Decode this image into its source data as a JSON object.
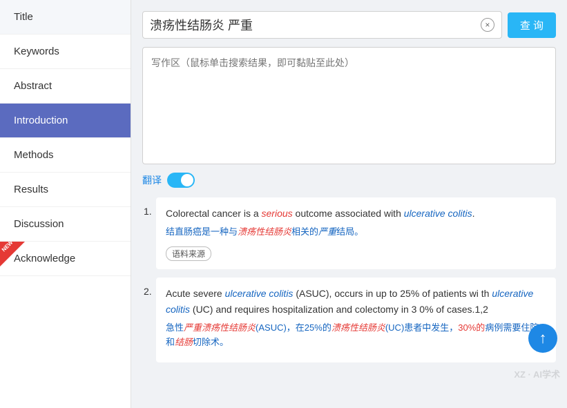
{
  "sidebar": {
    "items": [
      {
        "id": "title",
        "label": "Title",
        "active": false,
        "new": false
      },
      {
        "id": "keywords",
        "label": "Keywords",
        "active": false,
        "new": false
      },
      {
        "id": "abstract",
        "label": "Abstract",
        "active": false,
        "new": false
      },
      {
        "id": "introduction",
        "label": "Introduction",
        "active": true,
        "new": false
      },
      {
        "id": "methods",
        "label": "Methods",
        "active": false,
        "new": false
      },
      {
        "id": "results",
        "label": "Results",
        "active": false,
        "new": false
      },
      {
        "id": "discussion",
        "label": "Discussion",
        "active": false,
        "new": false
      },
      {
        "id": "acknowledge",
        "label": "Acknowledge",
        "active": false,
        "new": true
      }
    ]
  },
  "search": {
    "query": "溃疡性结肠炎 严重",
    "placeholder": "写作区（鼠标单击搜索结果，即可黏贴至此处）",
    "clear_label": "×",
    "query_button": "查 询"
  },
  "translate": {
    "label": "翻译"
  },
  "results": [
    {
      "number": "1.",
      "en": "Colorectal cancer is a",
      "en_italic_red": "serious",
      "en_mid": "outcome associated with",
      "en_italic_blue": "ulcerative colitis",
      "en_end": ".",
      "zh_pre": "结直肠癌是一种与",
      "zh_italic": "溃疡性结肠炎",
      "zh_mid": "相关的",
      "zh_italic2": "严重",
      "zh_end": "结局。",
      "source_tag": "语料来源"
    },
    {
      "number": "2.",
      "en_line1": "Acute severe",
      "en_italic1": "ulcerative colitis",
      "en_line1b": "(ASUC), occurs in up to 25% of patients wi",
      "en_line2": "th",
      "en_italic2": "ulcerative colitis",
      "en_line2b": "(UC) and requires hospitalization and colectomy in 3",
      "en_line3": "0% of cases.1,2",
      "zh_pre": "急性",
      "zh_italic1": "严重溃疡性结肠炎",
      "zh_mid1": "(ASUC)，在25%的",
      "zh_italic2": "溃疡性结肠炎",
      "zh_mid2": "(UC)患者中发生，",
      "zh_italic3": "30%的",
      "zh_end": "病例需要住院和",
      "zh_italic4": "结肠",
      "zh_end2": "切除术。"
    }
  ],
  "watermark": "XZ · AI学术",
  "scroll_top_icon": "↑"
}
